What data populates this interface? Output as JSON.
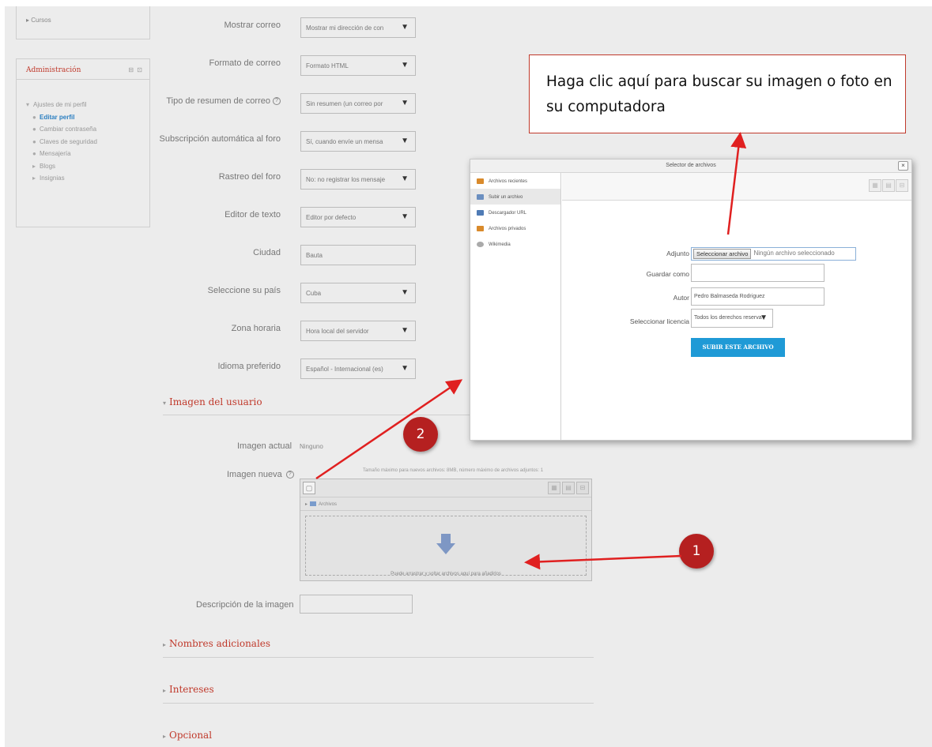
{
  "sidebar": {
    "courses_label": "Cursos",
    "admin": {
      "title": "Administración",
      "controls": "⊟ ⊡",
      "items": [
        {
          "label": "Ajustes de mi perfil",
          "bullet": "▾"
        },
        {
          "label": "Editar perfil",
          "bullet": "●"
        },
        {
          "label": "Cambiar contraseña",
          "bullet": "●"
        },
        {
          "label": "Claves de seguridad",
          "bullet": "●"
        },
        {
          "label": "Mensajería",
          "bullet": "●"
        },
        {
          "label": "Blogs",
          "bullet": "▸"
        },
        {
          "label": "Insignias",
          "bullet": "▸"
        }
      ]
    }
  },
  "form": {
    "mostrar_correo": {
      "label": "Mostrar correo",
      "value": "Mostrar mi dirección de con"
    },
    "formato_correo": {
      "label": "Formato de correo",
      "value": "Formato HTML"
    },
    "tipo_resumen": {
      "label": "Tipo de resumen de correo",
      "value": "Sin resumen (un correo por"
    },
    "subscripcion": {
      "label": "Subscripción automática al foro",
      "value": "Sí, cuando envíe un mensa"
    },
    "rastreo": {
      "label": "Rastreo del foro",
      "value": "No: no registrar los mensaje"
    },
    "editor": {
      "label": "Editor de texto",
      "value": "Editor por defecto"
    },
    "ciudad": {
      "label": "Ciudad",
      "value": "Bauta"
    },
    "pais": {
      "label": "Seleccione su país",
      "value": "Cuba"
    },
    "zona": {
      "label": "Zona horaria",
      "value": "Hora local del servidor"
    },
    "idioma": {
      "label": "Idioma preferido",
      "value": "Español - Internacional (es)"
    }
  },
  "imagen_section": {
    "title": "Imagen del usuario",
    "actual_label": "Imagen actual",
    "actual_value": "Ninguno",
    "nueva_label": "Imagen nueva",
    "filemanager_info": "Tamaño máximo para nuevos archivos: 8MB, número máximo de archivos adjuntos: 1",
    "folder_label": "Archivos",
    "drop_message": "Puede arrastrar y soltar archivos aquí para añadirlos",
    "descripcion_label": "Descripción de la imagen"
  },
  "collapsed_sections": [
    {
      "title": "Nombres adicionales"
    },
    {
      "title": "Intereses"
    },
    {
      "title": "Opcional"
    }
  ],
  "file_picker": {
    "title": "Selector de archivos",
    "close": "×",
    "repositories": [
      {
        "label": "Archivos recientes",
        "icon": "recent-icon"
      },
      {
        "label": "Subir un archivo",
        "icon": "upload-icon"
      },
      {
        "label": "Descargador URL",
        "icon": "url-icon"
      },
      {
        "label": "Archivos privados",
        "icon": "private-files-icon"
      },
      {
        "label": "Wikimedia",
        "icon": "wikimedia-icon"
      }
    ],
    "adjunto_label": "Adjunto",
    "choose_button": "Seleccionar archivo",
    "no_file": "Ningún archivo seleccionado",
    "guardar_label": "Guardar como",
    "guardar_value": "",
    "autor_label": "Autor",
    "autor_value": "Pedro Balmaseda Rodriguez",
    "licencia_label": "Seleccionar licencia",
    "licencia_value": "Todos los derechos reserva",
    "upload_button": "SUBIR ESTE ARCHIVO"
  },
  "annotations": {
    "callout_text": "Haga clic aquí para buscar su imagen o foto en su computadora",
    "badge_1": "1",
    "badge_2": "2",
    "arrow_color": "#e02020"
  },
  "colors": {
    "accent_red": "#c0392b",
    "link_blue": "#2b7fc1",
    "button_blue": "#1f9ad6"
  }
}
